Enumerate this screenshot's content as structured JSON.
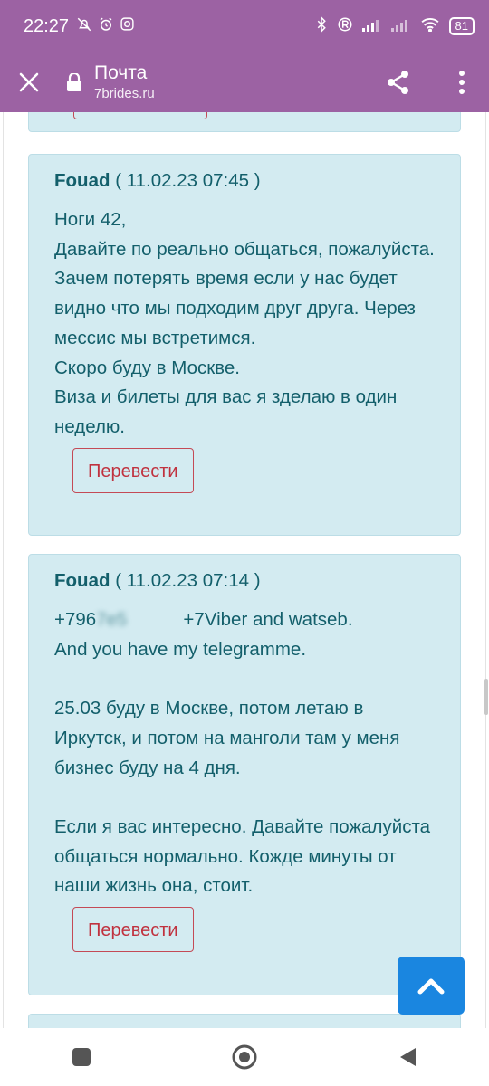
{
  "status_bar": {
    "time": "22:27",
    "battery": "81"
  },
  "toolbar": {
    "title": "Почта",
    "url": "7brides.ru"
  },
  "messages": [
    {
      "author": "Fouad",
      "date": "( 11.02.23 07:45 )",
      "body": "Ноги 42,\nДавайте по реально общаться, пожалуйста. Зачем потерять время если у нас будет видно что мы подходим друг друга. Через мессис мы встретимся.\nСкоро буду в Москве.\nВиза и билеты для вас я зделаю в один неделю.",
      "translate_label": "Перевести"
    },
    {
      "author": "Fouad",
      "date": "( 11.02.23 07:14 )",
      "phone_prefix": "+796",
      "phone_blurred": "7e5",
      "phone_second": "+7",
      "line1_rest": "Viber and watseb.",
      "body": "And you have my telegramme.\n\n25.03 буду в Москве, потом летаю в Иркутск, и потом на манголи там у меня бизнес буду на 4 дня.\n\nЕсли я вас интересно. Давайте пожалуйста общаться нормально. Кожде минуты от наши жизнь она, стоит.",
      "translate_label": "Перевести"
    }
  ],
  "colors": {
    "toolbar": "#9c62a3",
    "card_bg": "#d3ebf1",
    "text": "#135f6b",
    "translate": "#c0323f",
    "fab": "#1a86e0"
  }
}
